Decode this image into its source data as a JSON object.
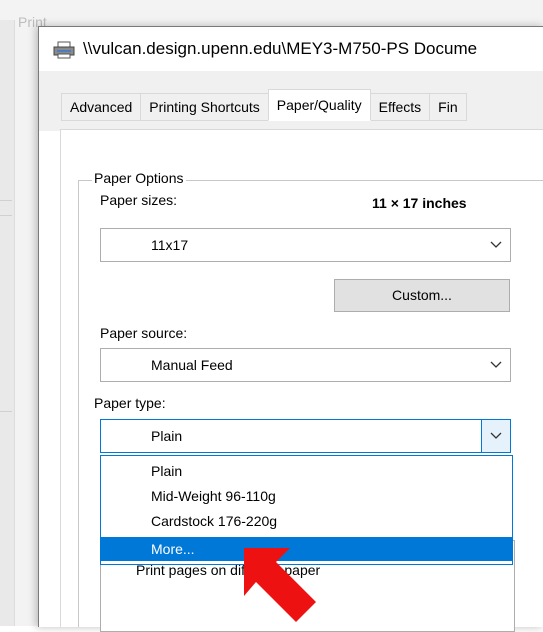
{
  "background_window": {
    "title": "Print"
  },
  "dialog": {
    "title": "\\\\vulcan.design.upenn.edu\\MEY3-M750-PS Docume",
    "tabs": [
      {
        "label": "Advanced"
      },
      {
        "label": "Printing Shortcuts"
      },
      {
        "label": "Paper/Quality"
      },
      {
        "label": "Effects"
      },
      {
        "label": "Fin"
      }
    ],
    "active_tab": "Paper/Quality"
  },
  "paper_options": {
    "legend": "Paper Options",
    "paper_sizes_label": "Paper sizes:",
    "size_readout": "11 × 17 inches",
    "paper_size_value": "11x17",
    "custom_button": "Custom...",
    "paper_source_label": "Paper source:",
    "paper_source_value": "Manual Feed",
    "paper_type_label": "Paper type:",
    "paper_type_value": "Plain",
    "paper_type_options": [
      {
        "label": "Plain"
      },
      {
        "label": "Mid-Weight 96-110g"
      },
      {
        "label": "Cardstock 176-220g"
      },
      {
        "label": "More..."
      }
    ],
    "highlighted_option": "More...",
    "obscured_text": "Print pages on different paper"
  },
  "colors": {
    "accent": "#0078d7",
    "annotation_arrow": "#ee1111"
  }
}
